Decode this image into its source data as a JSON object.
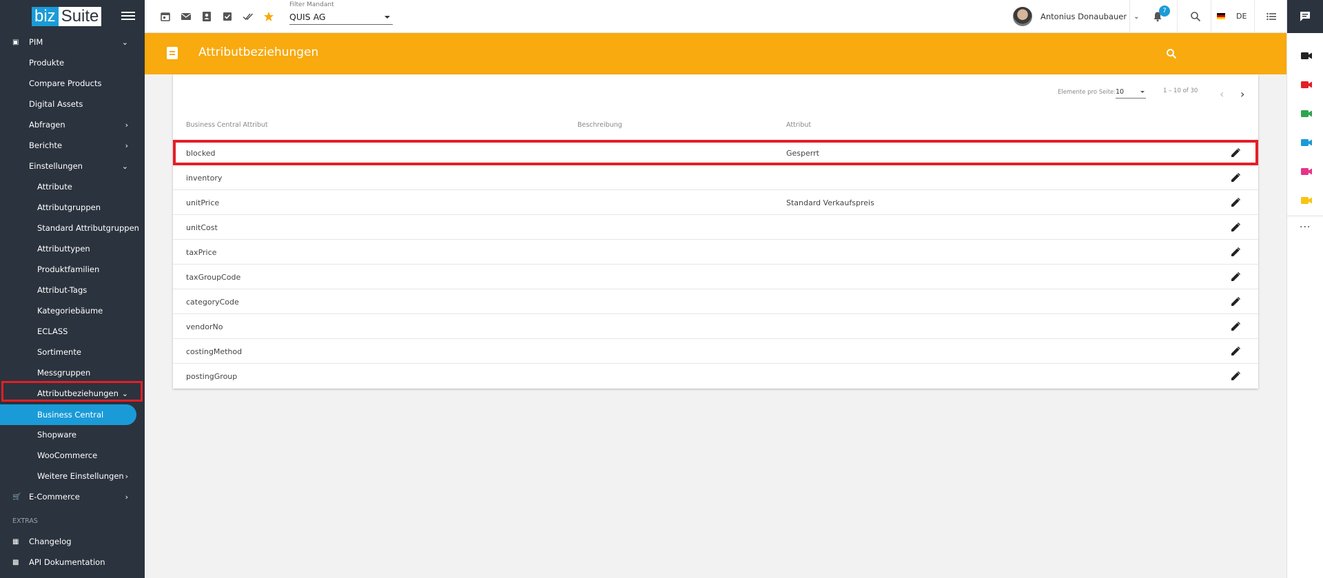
{
  "app": {
    "logo_biz": "biz",
    "logo_suite": "Suite"
  },
  "sidebar": {
    "pim_label": "PIM",
    "items": [
      {
        "label": "Produkte"
      },
      {
        "label": "Compare Products"
      },
      {
        "label": "Digital Assets"
      },
      {
        "label": "Abfragen"
      },
      {
        "label": "Berichte"
      },
      {
        "label": "Einstellungen"
      },
      {
        "label": "Attribute"
      },
      {
        "label": "Attributgruppen"
      },
      {
        "label": "Standard Attributgruppen"
      },
      {
        "label": "Attributtypen"
      },
      {
        "label": "Produktfamilien"
      },
      {
        "label": "Attribut-Tags"
      },
      {
        "label": "Kategoriebäume"
      },
      {
        "label": "ECLASS"
      },
      {
        "label": "Sortimente"
      },
      {
        "label": "Messgruppen"
      },
      {
        "label": "Attributbeziehungen"
      },
      {
        "label": "Business Central"
      },
      {
        "label": "Shopware"
      },
      {
        "label": "WooCommerce"
      },
      {
        "label": "Weitere Einstellungen"
      }
    ],
    "ecommerce_label": "E-Commerce",
    "extras_section": "EXTRAS",
    "changelog_label": "Changelog",
    "api_label": "API Dokumentation"
  },
  "topbar": {
    "filter_label": "Filter Mandant",
    "filter_value": "QUIS AG",
    "user_name": "Antonius Donaubauer",
    "notification_count": "7",
    "language": "DE"
  },
  "header": {
    "title": "Attributbeziehungen"
  },
  "table": {
    "pager_label": "Elemente pro Seite:",
    "page_size": "10",
    "range": "1 – 10 of 30",
    "columns": [
      "Business Central Attribut",
      "Beschreibung",
      "Attribut"
    ],
    "rows": [
      {
        "bc": "blocked",
        "desc": "",
        "attr": "Gesperrt"
      },
      {
        "bc": "inventory",
        "desc": "",
        "attr": ""
      },
      {
        "bc": "unitPrice",
        "desc": "",
        "attr": "Standard Verkaufspreis"
      },
      {
        "bc": "unitCost",
        "desc": "",
        "attr": ""
      },
      {
        "bc": "taxPrice",
        "desc": "",
        "attr": ""
      },
      {
        "bc": "taxGroupCode",
        "desc": "",
        "attr": ""
      },
      {
        "bc": "categoryCode",
        "desc": "",
        "attr": ""
      },
      {
        "bc": "vendorNo",
        "desc": "",
        "attr": ""
      },
      {
        "bc": "costingMethod",
        "desc": "",
        "attr": ""
      },
      {
        "bc": "postingGroup",
        "desc": "",
        "attr": ""
      }
    ]
  },
  "colors": {
    "sidebar_bg": "#2b333e",
    "accent": "#1a9bd7",
    "header_orange": "#f8aa0e",
    "highlight_red": "#e41e26",
    "rail_icons": [
      "#222222",
      "#e41e26",
      "#2ea44f",
      "#1a9bd7",
      "#e8338a",
      "#f8c40e"
    ]
  }
}
